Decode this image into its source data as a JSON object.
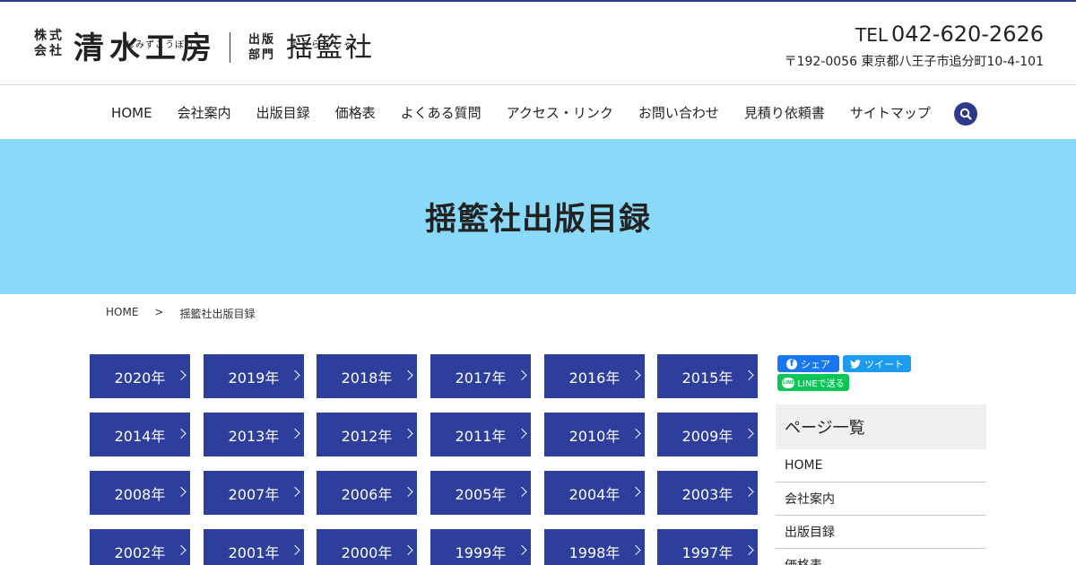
{
  "brand": {
    "corp_line1": "株式",
    "corp_line2": "会社",
    "name": "清水工房",
    "name_ruby": "しみずこうぼう",
    "division_line1": "出版",
    "division_line2": "部門",
    "sub_name": "揺籃社",
    "sub_ruby": "ようらんしゃ"
  },
  "contact": {
    "tel_label": "TEL",
    "tel_number": "042-620-2626",
    "address": "〒192-0056 東京都八王子市追分町10-4-101"
  },
  "nav": {
    "items": [
      {
        "label": "HOME"
      },
      {
        "label": "会社案内"
      },
      {
        "label": "出版目録"
      },
      {
        "label": "価格表"
      },
      {
        "label": "よくある質問"
      },
      {
        "label": "アクセス・リンク"
      },
      {
        "label": "お問い合わせ"
      },
      {
        "label": "見積り依頼書"
      },
      {
        "label": "サイトマップ"
      }
    ],
    "search_icon": "search-icon"
  },
  "hero": {
    "title": "揺籃社出版目録"
  },
  "breadcrumb": {
    "home": "HOME",
    "separator": ">",
    "current": "揺籃社出版目録"
  },
  "years": [
    {
      "label": "2020年"
    },
    {
      "label": "2019年"
    },
    {
      "label": "2018年"
    },
    {
      "label": "2017年"
    },
    {
      "label": "2016年"
    },
    {
      "label": "2015年"
    },
    {
      "label": "2014年"
    },
    {
      "label": "2013年"
    },
    {
      "label": "2012年"
    },
    {
      "label": "2011年"
    },
    {
      "label": "2010年"
    },
    {
      "label": "2009年"
    },
    {
      "label": "2008年"
    },
    {
      "label": "2007年"
    },
    {
      "label": "2006年"
    },
    {
      "label": "2005年"
    },
    {
      "label": "2004年"
    },
    {
      "label": "2003年"
    },
    {
      "label": "2002年"
    },
    {
      "label": "2001年"
    },
    {
      "label": "2000年"
    },
    {
      "label": "1999年"
    },
    {
      "label": "1998年"
    },
    {
      "label": "1997年"
    }
  ],
  "share": {
    "facebook": "シェア",
    "twitter": "ツイート",
    "line": "LINEで送る",
    "line_icon_text": "LINE"
  },
  "sidebar": {
    "title": "ページ一覧",
    "items": [
      {
        "label": "HOME"
      },
      {
        "label": "会社案内"
      },
      {
        "label": "出版目録"
      },
      {
        "label": "価格表"
      }
    ]
  },
  "colors": {
    "accent": "#2d3e9c",
    "hero_bg": "#8ad9f8",
    "facebook": "#1877f2",
    "twitter": "#1d9bf0",
    "line": "#06c755"
  }
}
